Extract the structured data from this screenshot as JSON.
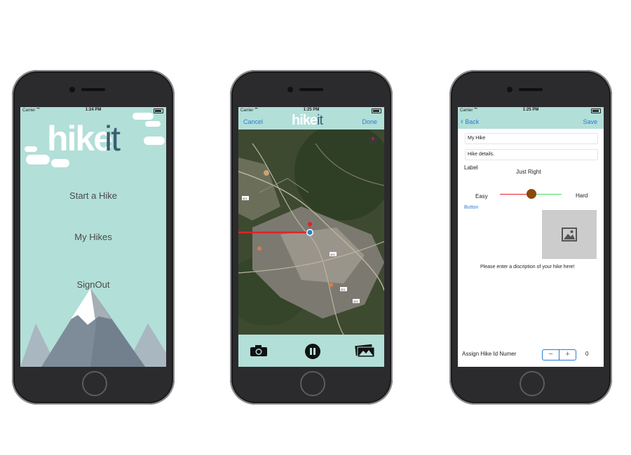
{
  "status": {
    "carrier": "Carrier"
  },
  "screen1": {
    "time": "1:24 PM",
    "logo_hike": "hike",
    "logo_it": "it",
    "menu": [
      "Start a Hike",
      "My Hikes",
      "SignOut"
    ]
  },
  "screen2": {
    "time": "1:25 PM",
    "cancel": "Cancel",
    "done": "Done",
    "logo_hike": "hike",
    "logo_it": "it",
    "route_labels": [
      "321",
      "321",
      "321",
      "321"
    ],
    "icons": [
      "camera-icon",
      "pause-icon",
      "photos-icon"
    ]
  },
  "screen3": {
    "time": "1:25 PM",
    "back": "Back",
    "save": "Save",
    "name_value": "My Hike",
    "details_value": "Hike details.",
    "label": "Label",
    "difficulty_value": "Just Right",
    "easy": "Easy",
    "hard": "Hard",
    "difficulty_fraction": 0.55,
    "button": "Button",
    "description_prompt": "Please enter a discription of your hike here!",
    "assign_label": "Assign Hike Id Numer",
    "stepper_minus": "−",
    "stepper_plus": "+",
    "counter": "0"
  },
  "colors": {
    "mint": "#b2dfd8",
    "blue": "#2b7cd0",
    "slider_thumb": "#8b4a0e"
  }
}
